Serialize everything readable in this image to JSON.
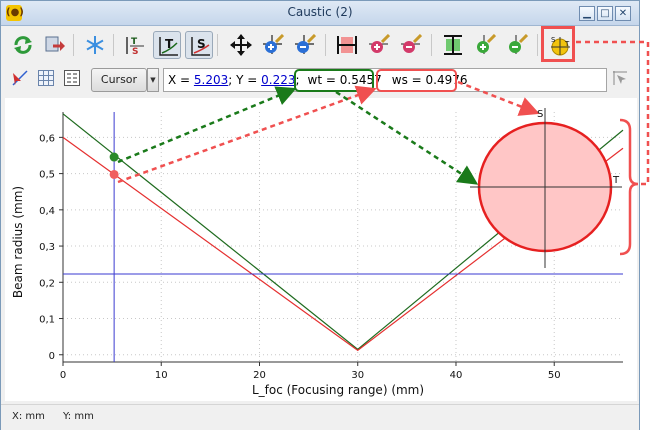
{
  "window": {
    "title": "Caustic (2)",
    "app_icon": "app-logo-icon",
    "controls": [
      "minimize",
      "maximize",
      "close"
    ],
    "minimize_glyph": "▁",
    "maximize_glyph": "□",
    "close_glyph": "✕"
  },
  "toolbar": {
    "buttons": [
      {
        "name": "refresh-icon"
      },
      {
        "name": "export-icon"
      },
      {
        "name": "freeze-icon"
      },
      {
        "name": "ts-toggle-icon"
      },
      {
        "name": "tangential-plot-icon",
        "pressed": true
      },
      {
        "name": "sagittal-plot-icon",
        "pressed": true
      },
      {
        "name": "zoom-fit-icon"
      },
      {
        "name": "zoom-in-icon"
      },
      {
        "name": "zoom-out-icon"
      },
      {
        "name": "zoom-fit-horizontal-icon"
      },
      {
        "name": "zoom-in-horizontal-icon"
      },
      {
        "name": "zoom-out-horizontal-icon"
      },
      {
        "name": "zoom-fit-vertical-icon"
      },
      {
        "name": "zoom-in-vertical-icon"
      },
      {
        "name": "zoom-out-vertical-icon"
      },
      {
        "name": "beam-shape-icon",
        "highlighted": true
      }
    ],
    "ts_label_t": "T",
    "ts_label_s": "S",
    "plot_t_label": "T",
    "plot_s_label": "S"
  },
  "cursor_bar": {
    "cursor_button_label": "Cursor",
    "x_prefix": "X = ",
    "x_value": "5.203",
    "y_prefix": "; Y = ",
    "y_value": "0.223",
    "sep": ";",
    "wt_text": "wt = 0.5457",
    "ws_text": "ws = 0.4976"
  },
  "chart_data": {
    "type": "line",
    "xlabel": "L_foc (Focusing range) (mm)",
    "ylabel": "Beam radius (mm)",
    "xlim": [
      0,
      57
    ],
    "ylim": [
      -0.02,
      0.67
    ],
    "x_ticks": [
      0,
      10,
      20,
      30,
      40,
      50
    ],
    "y_ticks": [
      0,
      0.1,
      0.2,
      0.3,
      0.4,
      0.5,
      0.6
    ],
    "y_tick_labels": [
      "0",
      "0,1",
      "0,2",
      "0,3",
      "0,4",
      "0,5",
      "0,6"
    ],
    "grid": true,
    "series": [
      {
        "points": [
          [
            0,
            0.665
          ],
          [
            30,
            0.015
          ],
          [
            57,
            0.62
          ]
        ],
        "color": "#1f6b1f"
      },
      {
        "points": [
          [
            0,
            0.6
          ],
          [
            30,
            0.012
          ],
          [
            57,
            0.57
          ]
        ],
        "color": "#e53030"
      }
    ],
    "cursor": {
      "x": 5.203,
      "y": 0.223,
      "color": "#3a3ad0"
    },
    "markers": [
      {
        "x": 5.203,
        "y": 0.5457,
        "color": "#2a8a2a"
      },
      {
        "x": 5.203,
        "y": 0.4976,
        "color": "#f06060"
      }
    ]
  },
  "beam_shape": {
    "s_label": "S",
    "t_label": "T",
    "fill": "#ffc6c6",
    "stroke": "#e62020"
  },
  "status": {
    "x_units": "X: mm",
    "y_units": "Y: mm"
  },
  "colors": {
    "annotation_green": "#1a7a1a",
    "annotation_red": "#f05050"
  }
}
